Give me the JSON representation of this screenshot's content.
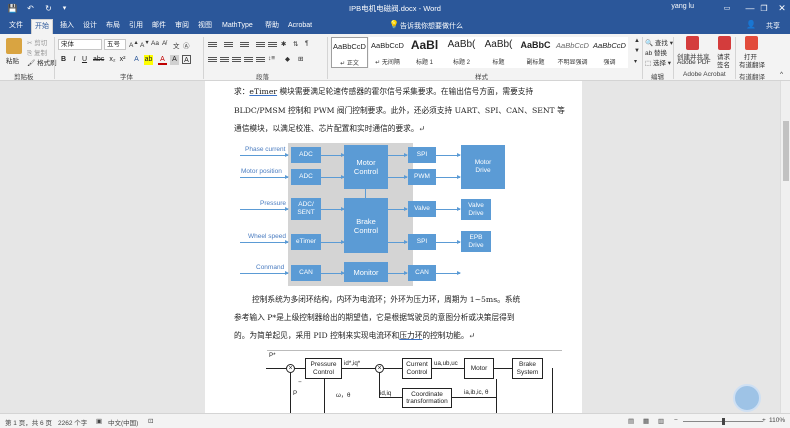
{
  "titlebar": {
    "doc_title": "IPB电机电磁阀.docx - Word",
    "user": "yang lu",
    "min": "—",
    "restore": "❐",
    "close": "✕"
  },
  "tabs": [
    "文件",
    "开始",
    "插入",
    "设计",
    "布局",
    "引用",
    "邮件",
    "审阅",
    "视图",
    "MathType",
    "帮助",
    "Acrobat"
  ],
  "tell_me": "告诉我你想要做什么",
  "share": "共享",
  "ribbon": {
    "clipboard": {
      "paste": "粘贴",
      "cut": "剪切",
      "copy": "复制",
      "format_painter": "格式刷",
      "label": "剪贴板"
    },
    "font": {
      "font_name": "宋体",
      "font_size": "五号",
      "label": "字体"
    },
    "paragraph_label": "段落",
    "styles": {
      "label": "样式",
      "items": [
        {
          "sample": "AaBbCcD",
          "name": "正文",
          "selected": true
        },
        {
          "sample": "AaBbCcD",
          "name": "无间隔",
          "selected": false
        },
        {
          "sample": "AaBl",
          "name": "标题 1",
          "selected": false
        },
        {
          "sample": "AaBb(",
          "name": "标题 2",
          "selected": false
        },
        {
          "sample": "AaBb(",
          "name": "标题",
          "selected": false
        },
        {
          "sample": "AaBbC",
          "name": "副标题",
          "selected": false
        },
        {
          "sample": "AaBbCcD",
          "name": "不明显强调",
          "selected": false
        },
        {
          "sample": "AaBbCcD",
          "name": "强调",
          "selected": false
        }
      ]
    },
    "editing": {
      "find": "查找",
      "replace": "替换",
      "select": "选择",
      "label": "编辑"
    },
    "acrobat": {
      "create_share": "创建并共享",
      "adobe_pdf": "Adobe PDF",
      "request_sign": "请求",
      "request_sign2": "签名",
      "label": "Adobe Acrobat"
    },
    "open": {
      "open": "打开",
      "translate": "有道翻译",
      "label": "有道翻译"
    }
  },
  "document": {
    "para1": {
      "line1_pre": "求：",
      "line1_etimer": "eTimer",
      "line1_post": " 模块需要满足轮速传感器的霍尔信号采集要求。在输出信号方面，需要支持",
      "line2": "BLDC/PMSM 控制和 PWM 阀门控制要求。此外，还必须支持 UART、SPI、CAN、SENT 等",
      "line3": "通信模块，以满足校准、芯片配置和实时通信的要求。↵"
    },
    "para2": {
      "line1": "控制系统为多闭环结构，内环为电流环；外环为压力环，周期为 1~5ms。系统",
      "line2": "参考输入 P*是上级控制器给出的期望值，它是根据驾驶员的意图分析或决策层得到",
      "line3_pre": "的。为简单起见，采用 PID 控制来实现电流环和",
      "line3_u": "压力环",
      "line3_post": "的控制功能。↵"
    }
  },
  "fig1": {
    "signals": [
      "Phase current",
      "Motor position",
      "Pressure",
      "Wheel speed",
      "Conmand"
    ],
    "col1": [
      "ADC",
      "ADC",
      "ADC/\nSENT",
      "eTimer",
      "CAN"
    ],
    "motor_control": "Motor\nControl",
    "brake_control": "Brake\nControl",
    "monitor": "Monitor",
    "col3": [
      "SPI",
      "PWM",
      "Valve",
      "SPI",
      "CAN"
    ],
    "outputs": [
      "Motor\nDrive",
      "Valve\nDrive",
      "EPB\nDrive"
    ]
  },
  "fig2": {
    "p_star": "P*",
    "pressure_control": "Pressure\nControl",
    "idq_star": "id*,iq*",
    "current_control": "Current\nControl",
    "uabc": "ua,ub,uc",
    "motor": "Motor",
    "brake_system": "Brake\nSystem",
    "p_feedback": "P",
    "omega": "ω，θ",
    "idq": "id,iq",
    "coord": "Coordinate\ntransformation",
    "iabc": "ia,ib,ic, θ",
    "minus": "−",
    "plus": "+"
  },
  "status": {
    "page": "第 1 页，共 6 页",
    "words": "2262 个字",
    "lang": "中文(中国)",
    "zoom": "110%"
  }
}
